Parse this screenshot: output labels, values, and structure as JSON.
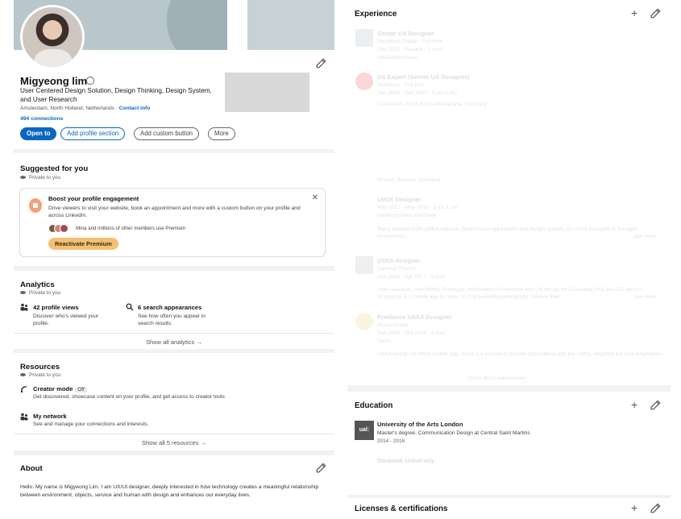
{
  "profile": {
    "name": "Migyeong lim",
    "headline": "User Centered Design Solution, Design Thinking, Design System, and User Research",
    "location": "Amsterdam, North Holland, Netherlands · ",
    "contact_info": "Contact info",
    "connections": "494 connections",
    "buttons": {
      "open_to": "Open to",
      "add_profile_section": "Add profile section",
      "add_custom_button": "Add custom button",
      "more": "More"
    }
  },
  "suggested": {
    "title": "Suggested for you",
    "private": "Private to you",
    "promo": {
      "title": "Boost your profile engagement",
      "text": "Drive viewers to visit your website, book an appointment and more with a custom button on your profile and across LinkedIn.",
      "members": "Mina and millions of other members use Premium",
      "button": "Reactivate Premium"
    }
  },
  "analytics": {
    "title": "Analytics",
    "private": "Private to you",
    "stats": [
      {
        "title": "42 profile views",
        "desc": "Discover who's viewed your profile."
      },
      {
        "title": "6 search appearances",
        "desc": "See how often you appear in search results."
      }
    ],
    "show_all": "Show all analytics →"
  },
  "resources": {
    "title": "Resources",
    "private": "Private to you",
    "items": [
      {
        "title": "Creator mode",
        "badge": "Off",
        "desc": "Get discovered, showcase content on your profile, and get access to creator tools"
      },
      {
        "title": "My network",
        "desc": "See and manage your connections and interests."
      }
    ],
    "show_all": "Show all 5 resources →"
  },
  "about": {
    "title": "About",
    "text": "Hello. My name is Migyeong Lim. I am UX/UI designer, deeply interested in how technology creates a meaningful relationship between environment, objects, service and human with design and enhances our everyday lives."
  },
  "experience": {
    "title": "Experience",
    "add_icon": "+",
    "items": [
      {
        "role": "Senior UX Designer",
        "company": "Decathlon Digital · Full-time",
        "dates": "Dec 2022 - Present · 2 mos",
        "place": "Amsterdam Area"
      },
      {
        "role": "UX Expert (Senior UX Designer)",
        "company": "Vodafone · Full-time",
        "dates": "Dec 2020 - Dec 2022 · 2 yrs 1 mo",
        "place": "Düsseldorf, North Rhine-Westphalia, Germany"
      },
      {
        "role": "",
        "company": "",
        "dates": "",
        "place": "Munich, Bavaria, Germany"
      },
      {
        "role": "UI/UX Designer",
        "company": "",
        "dates": "May 2017 - May 2019 · 2 yrs 1 mo",
        "place": "Hamburg Area, Germany",
        "desc": "Many develop EON global editions, Smart home application and design system, as UX/UI Designer in the agile environment...",
        "more": "...see more"
      },
      {
        "role": "UX/UI designer",
        "company": "Daewoo Fintech",
        "dates": "Nov 2016 - Apr 2017 · 6 mos",
        "place": "",
        "desc": "User research, Low-fidelity Prototype, Information Architecture and UX design for Dr.posting UX1 and 2.0 service. Dr.posting is a mobile app for users to find available parking lots, reserve their ...",
        "more": "...see more"
      },
      {
        "role": "Freelance UX/UI Designer",
        "company": "Wooof Korea",
        "dates": "Sep 2016 - Oct 2016 · 2 mos",
        "place": "Seoul",
        "desc": "UX/UI Design for Woof mobile app. Woof is a service to provide dog walking and pet sitting, targeting full-time employees."
      }
    ],
    "show_all": "Show all 12 experiences →"
  },
  "education": {
    "title": "Education",
    "add_icon": "+",
    "logo_text": "ual:",
    "school": "University of the Arts London",
    "degree": "Master's degree, Communication Design at Central Saint Martins",
    "years": "2014 - 2016",
    "next_school": "Dankook University"
  },
  "licenses": {
    "title": "Licenses & certifications",
    "add_icon": "+"
  },
  "icons": {
    "edit": "pencil-icon",
    "close": "✕",
    "eye": "eye-icon"
  },
  "colors": {
    "brand_blue": "#0a66c2",
    "premium_gold": "#f5c075",
    "page_bg": "#f3f2ef"
  }
}
